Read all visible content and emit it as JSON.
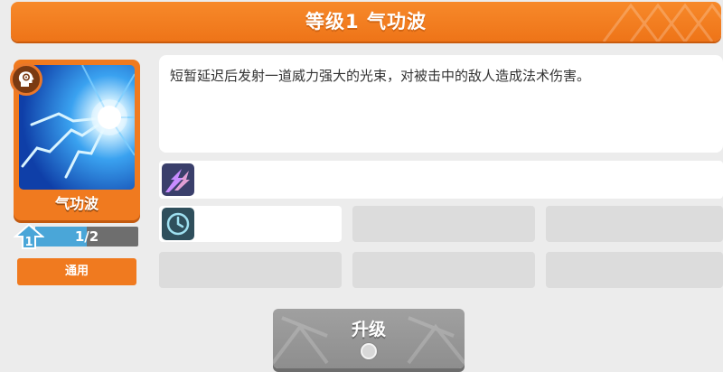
{
  "header": {
    "title": "等级1 气功波"
  },
  "skill": {
    "name": "气功波",
    "type_icon": "brain-head-icon",
    "level_text": "1/2",
    "level_progress": 0.5,
    "level_badge": "1",
    "tag": "通用"
  },
  "description": {
    "text": "短暂延迟后发射一道威力强大的光束，对被击中的敌人造成法术伤害。"
  },
  "stats": {
    "row1_icon": "energy-burst-icon",
    "row2_icon": "clock-icon"
  },
  "upgrade": {
    "label": "升级",
    "cost_icon": "coin-icon"
  },
  "colors": {
    "accent": "#f07a1f",
    "panel": "#ffffff",
    "disabled": "#dcdcdc",
    "button_disabled": "#999999"
  }
}
